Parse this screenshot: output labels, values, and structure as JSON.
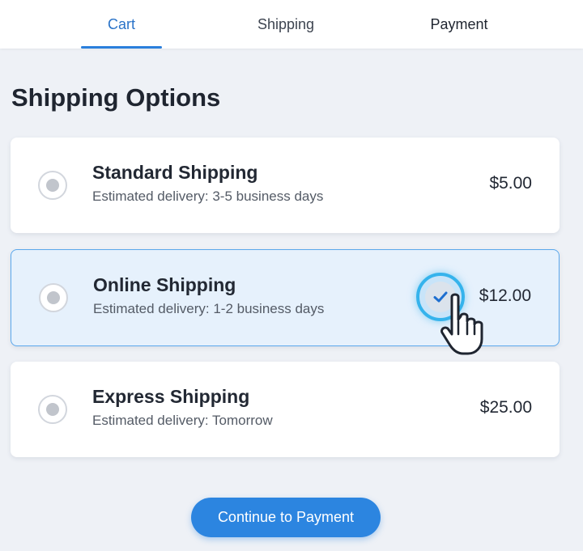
{
  "tabs": {
    "cart": "Cart",
    "shipping": "Shipping",
    "payment": "Payment",
    "active": "Cart"
  },
  "page_title": "Shipping Options",
  "options": [
    {
      "name": "Standard Shipping",
      "description": "Estimated delivery: 3-5 business days",
      "price": "$5.00"
    },
    {
      "name": "Online Shipping",
      "description": "Estimated delivery: 1-2 business days",
      "price": "$12.00",
      "highlighted": true
    },
    {
      "name": "Express Shipping",
      "description": "Estimated delivery: Tomorrow",
      "price": "$25.00"
    }
  ],
  "continue_button": "Continue to Payment",
  "icons": {
    "radio": "radio-icon",
    "check": "checkmark-icon",
    "pointer": "hand-pointer-icon"
  },
  "colors": {
    "accent": "#2c85e0",
    "highlight_bg": "#e6f1fc",
    "highlight_border": "#5aa7ec",
    "check_ring": "#35b3ec"
  }
}
